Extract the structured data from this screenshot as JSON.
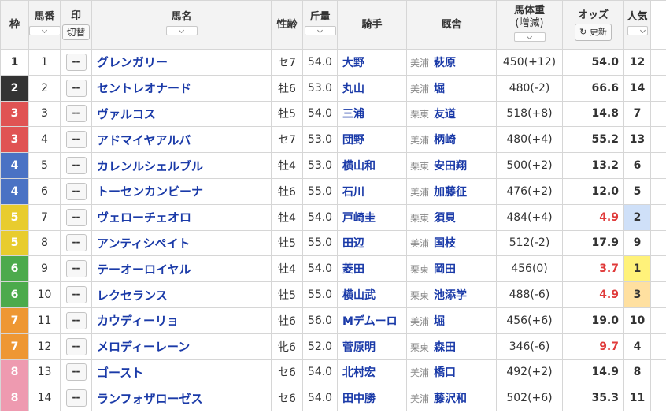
{
  "header": {
    "frame": "枠",
    "num": "馬番",
    "mark": "印",
    "mark_toggle": "切替",
    "name": "馬名",
    "sexage": "性齢",
    "weight": "斤量",
    "jockey": "騎手",
    "stable": "厩舎",
    "body": "馬体重",
    "body_sub": "(増減)",
    "odds": "オッズ",
    "refresh": "更新",
    "pop": "人気"
  },
  "colors": {
    "frame1": "#ffffff",
    "frame2": "#333333",
    "frame3": "#e05353",
    "frame4": "#4a72c4",
    "frame5": "#e8cc2e",
    "frame6": "#4caa4c",
    "frame7": "#ee9733",
    "frame8": "#ee9ab0",
    "odds_red": "#e03a3a",
    "pop1_bg": "#fff27a",
    "pop2_bg": "#cfe0f8",
    "pop3_bg": "#ffe0a0"
  },
  "rows": [
    {
      "frame": "1",
      "num": "1",
      "mark": "--",
      "name": "グレンガリー",
      "sexage": "セ7",
      "weight": "54.0",
      "jockey": "大野",
      "region": "美浦",
      "trainer": "萩原",
      "body": "450(+12)",
      "odds": "54.0",
      "pop": "12"
    },
    {
      "frame": "2",
      "num": "2",
      "mark": "--",
      "name": "セントレオナード",
      "sexage": "牡6",
      "weight": "53.0",
      "jockey": "丸山",
      "region": "美浦",
      "trainer": "堀",
      "body": "480(-2)",
      "odds": "66.6",
      "pop": "14"
    },
    {
      "frame": "3",
      "num": "3",
      "mark": "--",
      "name": "ヴァルコス",
      "sexage": "牡5",
      "weight": "54.0",
      "jockey": "三浦",
      "region": "栗東",
      "trainer": "友道",
      "body": "518(+8)",
      "odds": "14.8",
      "pop": "7"
    },
    {
      "frame": "3",
      "num": "4",
      "mark": "--",
      "name": "アドマイヤアルバ",
      "sexage": "セ7",
      "weight": "53.0",
      "jockey": "団野",
      "region": "美浦",
      "trainer": "柄崎",
      "body": "480(+4)",
      "odds": "55.2",
      "pop": "13"
    },
    {
      "frame": "4",
      "num": "5",
      "mark": "--",
      "name": "カレンルシェルブル",
      "sexage": "牡4",
      "weight": "53.0",
      "jockey": "横山和",
      "region": "栗東",
      "trainer": "安田翔",
      "body": "500(+2)",
      "odds": "13.2",
      "pop": "6"
    },
    {
      "frame": "4",
      "num": "6",
      "mark": "--",
      "name": "トーセンカンビーナ",
      "sexage": "牡6",
      "weight": "55.0",
      "jockey": "石川",
      "region": "美浦",
      "trainer": "加藤征",
      "body": "476(+2)",
      "odds": "12.0",
      "pop": "5"
    },
    {
      "frame": "5",
      "num": "7",
      "mark": "--",
      "name": "ヴェローチェオロ",
      "sexage": "牡4",
      "weight": "54.0",
      "jockey": "戸崎圭",
      "region": "栗東",
      "trainer": "須貝",
      "body": "484(+4)",
      "odds": "4.9",
      "pop": "2"
    },
    {
      "frame": "5",
      "num": "8",
      "mark": "--",
      "name": "アンティシペイト",
      "sexage": "牡5",
      "weight": "55.0",
      "jockey": "田辺",
      "region": "美浦",
      "trainer": "国枝",
      "body": "512(-2)",
      "odds": "17.9",
      "pop": "9"
    },
    {
      "frame": "6",
      "num": "9",
      "mark": "--",
      "name": "テーオーロイヤル",
      "sexage": "牡4",
      "weight": "54.0",
      "jockey": "菱田",
      "region": "栗東",
      "trainer": "岡田",
      "body": "456(0)",
      "odds": "3.7",
      "pop": "1"
    },
    {
      "frame": "6",
      "num": "10",
      "mark": "--",
      "name": "レクセランス",
      "sexage": "牡5",
      "weight": "55.0",
      "jockey": "横山武",
      "region": "栗東",
      "trainer": "池添学",
      "body": "488(-6)",
      "odds": "4.9",
      "pop": "3"
    },
    {
      "frame": "7",
      "num": "11",
      "mark": "--",
      "name": "カウディーリョ",
      "sexage": "牡6",
      "weight": "56.0",
      "jockey": "Mデムーロ",
      "region": "美浦",
      "trainer": "堀",
      "body": "456(+6)",
      "odds": "19.0",
      "pop": "10"
    },
    {
      "frame": "7",
      "num": "12",
      "mark": "--",
      "name": "メロディーレーン",
      "sexage": "牝6",
      "weight": "52.0",
      "jockey": "菅原明",
      "region": "栗東",
      "trainer": "森田",
      "body": "346(-6)",
      "odds": "9.7",
      "pop": "4"
    },
    {
      "frame": "8",
      "num": "13",
      "mark": "--",
      "name": "ゴースト",
      "sexage": "セ6",
      "weight": "54.0",
      "jockey": "北村宏",
      "region": "美浦",
      "trainer": "橋口",
      "body": "492(+2)",
      "odds": "14.9",
      "pop": "8"
    },
    {
      "frame": "8",
      "num": "14",
      "mark": "--",
      "name": "ランフォザローゼス",
      "sexage": "セ6",
      "weight": "54.0",
      "jockey": "田中勝",
      "region": "美浦",
      "trainer": "藤沢和",
      "body": "502(+6)",
      "odds": "35.3",
      "pop": "11"
    }
  ]
}
